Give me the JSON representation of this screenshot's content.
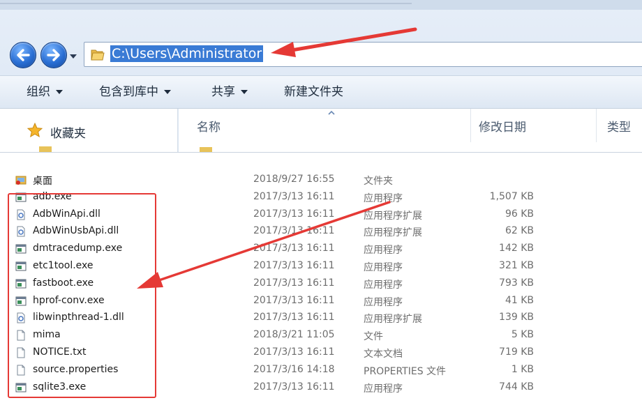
{
  "address": {
    "path": "C:\\Users\\Administrator"
  },
  "toolbar": {
    "organize": "组织",
    "include_library": "包含到库中",
    "share": "共享",
    "new_folder": "新建文件夹"
  },
  "nav": {
    "favorites": "收藏夹"
  },
  "columns": {
    "name": "名称",
    "date": "修改日期",
    "type": "类型"
  },
  "files": [
    {
      "icon": "desktop-folder-icon",
      "name": "桌面",
      "date": "2018/9/27 16:55",
      "type": "文件夹",
      "size": ""
    },
    {
      "icon": "exe-icon",
      "name": "adb.exe",
      "date": "2017/3/13 16:11",
      "type": "应用程序",
      "size": "1,507 KB"
    },
    {
      "icon": "dll-icon",
      "name": "AdbWinApi.dll",
      "date": "2017/3/13 16:11",
      "type": "应用程序扩展",
      "size": "96 KB"
    },
    {
      "icon": "dll-icon",
      "name": "AdbWinUsbApi.dll",
      "date": "2017/3/13 16:11",
      "type": "应用程序扩展",
      "size": "62 KB"
    },
    {
      "icon": "exe-icon",
      "name": "dmtracedump.exe",
      "date": "2017/3/13 16:11",
      "type": "应用程序",
      "size": "142 KB"
    },
    {
      "icon": "exe-icon",
      "name": "etc1tool.exe",
      "date": "2017/3/13 16:11",
      "type": "应用程序",
      "size": "321 KB"
    },
    {
      "icon": "exe-icon",
      "name": "fastboot.exe",
      "date": "2017/3/13 16:11",
      "type": "应用程序",
      "size": "793 KB"
    },
    {
      "icon": "exe-icon",
      "name": "hprof-conv.exe",
      "date": "2017/3/13 16:11",
      "type": "应用程序",
      "size": "41 KB"
    },
    {
      "icon": "dll-icon",
      "name": "libwinpthread-1.dll",
      "date": "2017/3/13 16:11",
      "type": "应用程序扩展",
      "size": "139 KB"
    },
    {
      "icon": "file-icon",
      "name": "mima",
      "date": "2018/3/21 11:05",
      "type": "文件",
      "size": "5 KB"
    },
    {
      "icon": "file-icon",
      "name": "NOTICE.txt",
      "date": "2017/3/13 16:11",
      "type": "文本文档",
      "size": "719 KB"
    },
    {
      "icon": "file-icon",
      "name": "source.properties",
      "date": "2017/3/16 14:18",
      "type": "PROPERTIES 文件",
      "size": "1 KB"
    },
    {
      "icon": "exe-icon",
      "name": "sqlite3.exe",
      "date": "2017/3/13 16:11",
      "type": "应用程序",
      "size": "744 KB"
    }
  ],
  "colors": {
    "annotation": "#e53935",
    "selection": "#3a7bd5",
    "nav_button": "#2a6fd4"
  }
}
